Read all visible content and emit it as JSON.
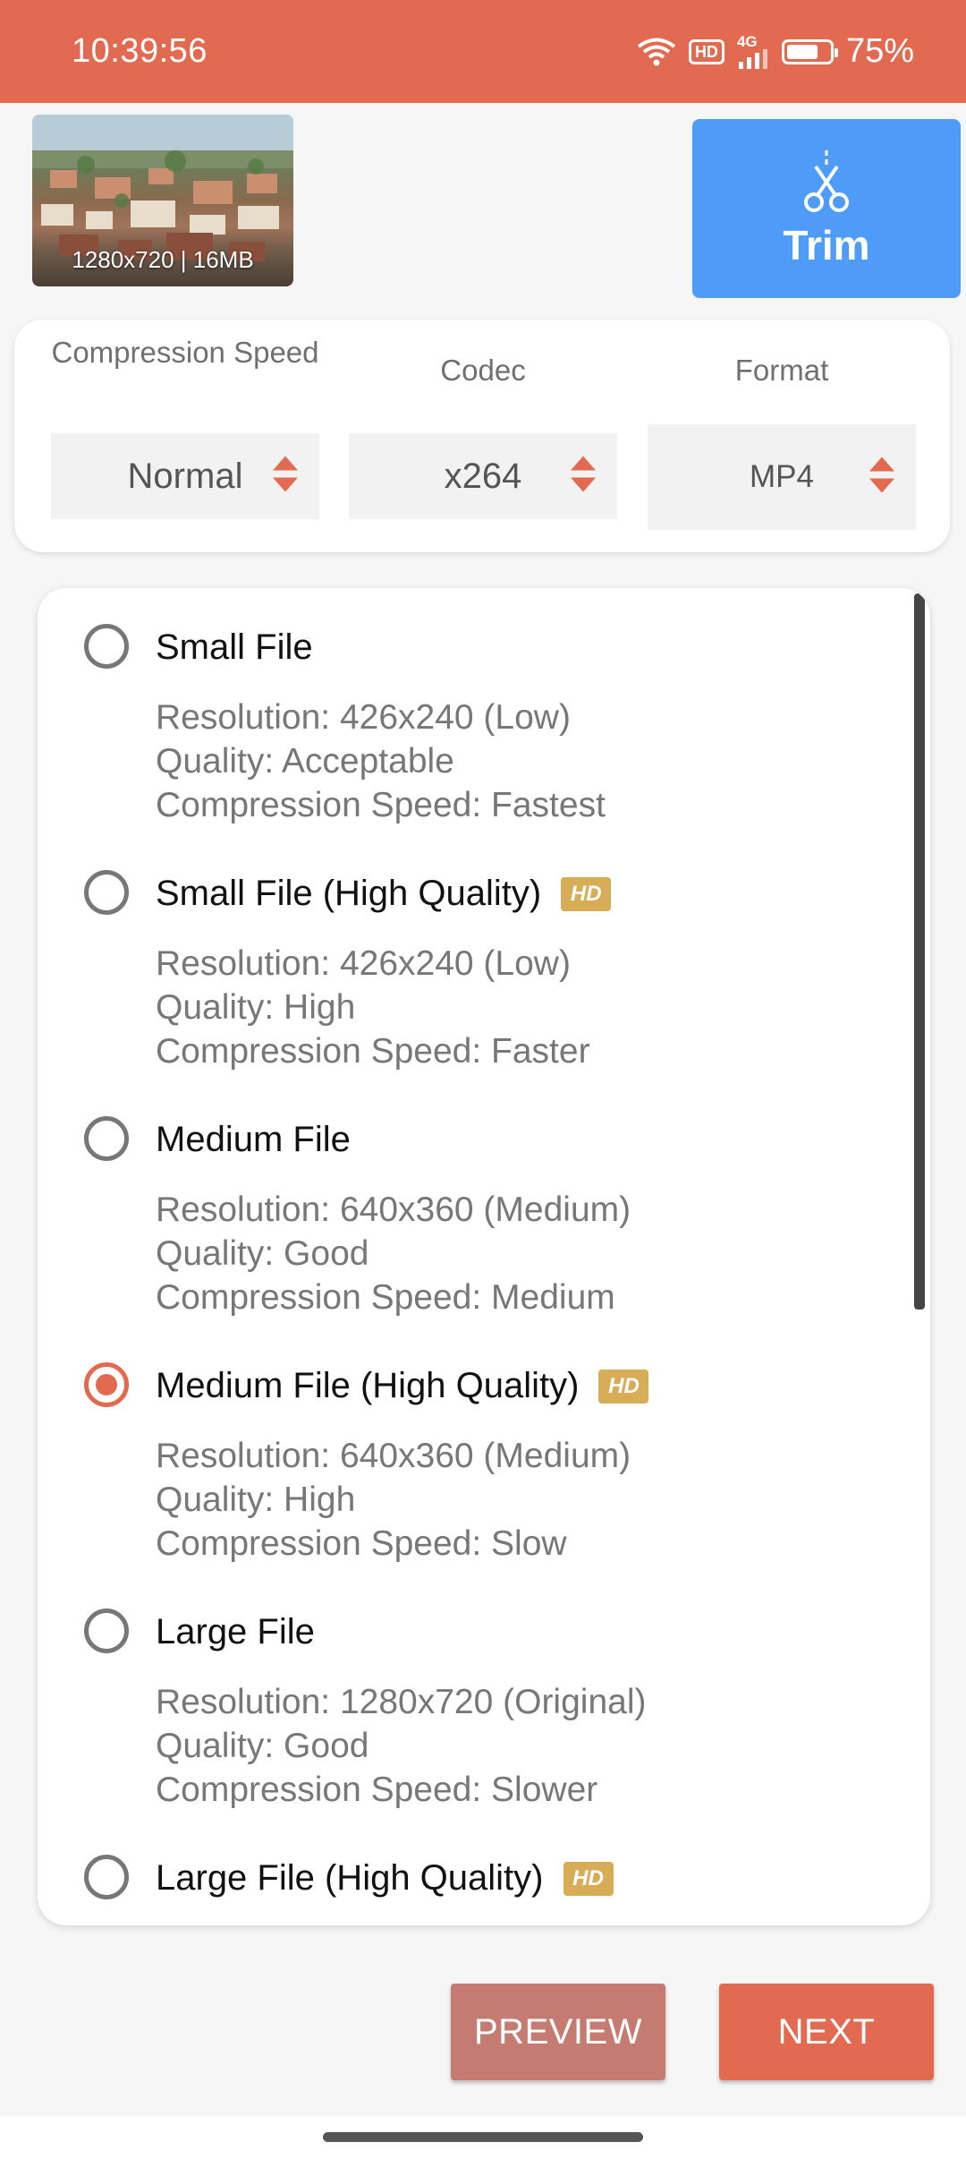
{
  "status_bar": {
    "time": "10:39:56",
    "hd": "HD",
    "network": "4G",
    "battery_percent": "75%",
    "battery_level": 0.75
  },
  "video": {
    "info": "1280x720 | 16MB"
  },
  "trim": {
    "label": "Trim"
  },
  "settings": {
    "compression_speed": {
      "label": "Compression Speed",
      "value": "Normal"
    },
    "codec": {
      "label": "Codec",
      "value": "x264"
    },
    "format": {
      "label": "Format",
      "value": "MP4"
    }
  },
  "options": [
    {
      "title": "Small File",
      "hd": false,
      "selected": false,
      "resolution": "Resolution: 426x240 (Low)",
      "quality": "Quality: Acceptable",
      "speed": "Compression Speed: Fastest"
    },
    {
      "title": "Small File (High Quality)",
      "hd": true,
      "selected": false,
      "resolution": "Resolution: 426x240 (Low)",
      "quality": "Quality: High",
      "speed": "Compression Speed: Faster"
    },
    {
      "title": "Medium File",
      "hd": false,
      "selected": false,
      "resolution": "Resolution: 640x360 (Medium)",
      "quality": "Quality: Good",
      "speed": "Compression Speed: Medium"
    },
    {
      "title": "Medium File (High Quality)",
      "hd": true,
      "selected": true,
      "resolution": "Resolution: 640x360 (Medium)",
      "quality": "Quality: High",
      "speed": "Compression Speed: Slow"
    },
    {
      "title": "Large File",
      "hd": false,
      "selected": false,
      "resolution": "Resolution: 1280x720 (Original)",
      "quality": "Quality: Good",
      "speed": "Compression Speed: Slower"
    },
    {
      "title": "Large File (High Quality)",
      "hd": true,
      "selected": false
    }
  ],
  "hd_badge": "HD",
  "buttons": {
    "preview": "PREVIEW",
    "next": "NEXT"
  },
  "colors": {
    "accent": "#e26a50",
    "trim_blue": "#4f9cf8",
    "hd_gold": "#d8ad57",
    "preview": "#c57b71"
  }
}
